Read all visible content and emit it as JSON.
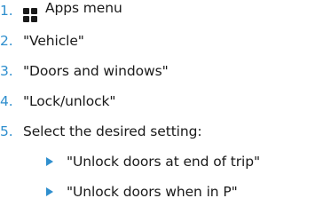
{
  "steps": [
    {
      "num": "1.",
      "icon": "apps-grid-icon",
      "label": "Apps menu"
    },
    {
      "num": "2.",
      "label": "\"Vehicle\""
    },
    {
      "num": "3.",
      "label": "\"Doors and windows\""
    },
    {
      "num": "4.",
      "label": "\"Lock/unlock\""
    },
    {
      "num": "5.",
      "label": "Select the desired setting:"
    }
  ],
  "options": [
    {
      "label": "\"Unlock doors at end of trip\""
    },
    {
      "label": "\"Unlock doors when in P\""
    }
  ],
  "colors": {
    "accent": "#2f8fce",
    "text": "#1a1a1a"
  }
}
